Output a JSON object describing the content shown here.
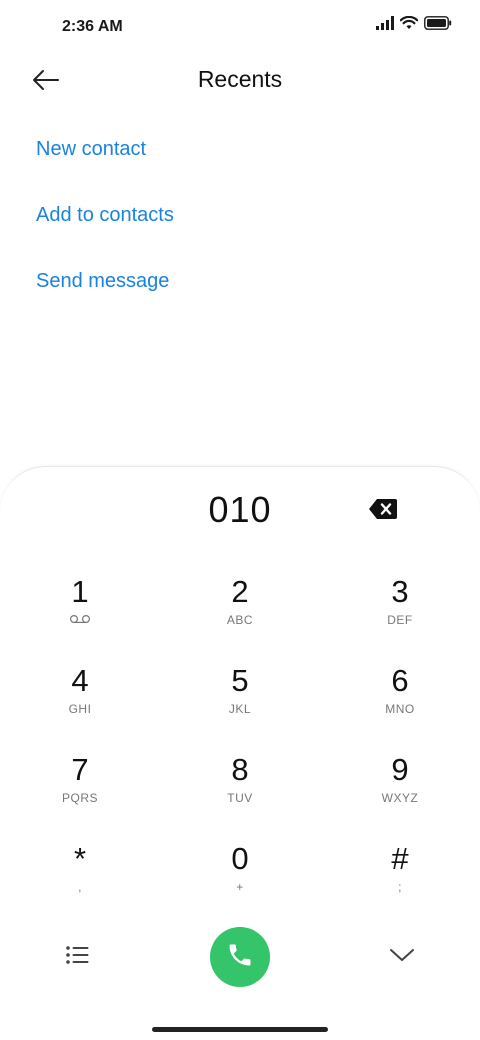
{
  "status_bar": {
    "time": "2:36 AM",
    "icons": [
      "signal-icon",
      "wifi-icon",
      "battery-icon"
    ]
  },
  "header": {
    "title": "Recents",
    "back_icon": "arrow-left-icon"
  },
  "actions": [
    {
      "label": "New contact"
    },
    {
      "label": "Add to contacts"
    },
    {
      "label": "Send message"
    }
  ],
  "dialer": {
    "number": "010",
    "backspace_icon": "backspace-icon",
    "keys": [
      [
        {
          "digit": "1",
          "letters": ""
        },
        {
          "digit": "2",
          "letters": "ABC"
        },
        {
          "digit": "3",
          "letters": "DEF"
        }
      ],
      [
        {
          "digit": "4",
          "letters": "GHI"
        },
        {
          "digit": "5",
          "letters": "JKL"
        },
        {
          "digit": "6",
          "letters": "MNO"
        }
      ],
      [
        {
          "digit": "7",
          "letters": "PQRS"
        },
        {
          "digit": "8",
          "letters": "TUV"
        },
        {
          "digit": "9",
          "letters": "WXYZ"
        }
      ],
      [
        {
          "digit": "*",
          "letters": ","
        },
        {
          "digit": "0",
          "letters": "+"
        },
        {
          "digit": "#",
          "letters": ";"
        }
      ]
    ],
    "menu_icon": "list-icon",
    "call_icon": "phone-icon",
    "collapse_icon": "chevron-down-icon"
  },
  "colors": {
    "accent": "#1a82e0",
    "call_green": "#34c46a"
  }
}
